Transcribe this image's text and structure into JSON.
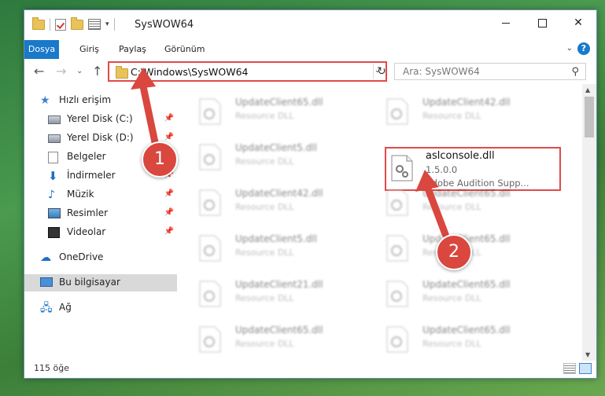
{
  "window": {
    "title": "SysWOW64",
    "controls": {
      "minimize": "",
      "maximize": "",
      "close": "✕"
    }
  },
  "ribbon": {
    "tabs": [
      "Dosya",
      "Giriş",
      "Paylaş",
      "Görünüm"
    ],
    "help": "?"
  },
  "address": {
    "path": "C:\\Windows\\SysWOW64",
    "search_placeholder": "Ara: SysWOW64"
  },
  "sidebar": {
    "items": [
      {
        "label": "Hızlı erişim",
        "icon": "star-icon"
      },
      {
        "label": "Yerel Disk (C:)",
        "icon": "disk-icon",
        "pinned": true
      },
      {
        "label": "Yerel Disk (D:)",
        "icon": "disk-icon",
        "pinned": true
      },
      {
        "label": "Belgeler",
        "icon": "document-icon",
        "pinned": true
      },
      {
        "label": "İndirmeler",
        "icon": "download-icon",
        "pinned": true
      },
      {
        "label": "Müzik",
        "icon": "music-icon",
        "pinned": true
      },
      {
        "label": "Resimler",
        "icon": "pictures-icon",
        "pinned": true
      },
      {
        "label": "Videolar",
        "icon": "video-icon",
        "pinned": true
      },
      {
        "label": "OneDrive",
        "icon": "cloud-icon"
      },
      {
        "label": "Bu bilgisayar",
        "icon": "computer-icon",
        "selected": true
      },
      {
        "label": "Ağ",
        "icon": "network-icon"
      }
    ]
  },
  "files": {
    "left": [
      {
        "name": "UpdateClient65.dll",
        "type": "Resource DLL"
      },
      {
        "name": "UpdateClient5.dll",
        "type": "Resource DLL"
      },
      {
        "name": "UpdateClient42.dll",
        "type": "Resource DLL"
      },
      {
        "name": "UpdateClient5.dll",
        "type": "Resource DLL"
      },
      {
        "name": "UpdateClient21.dll",
        "type": "Resource DLL"
      },
      {
        "name": "UpdateClient65.dll",
        "type": "Resource DLL"
      }
    ],
    "right": [
      {
        "name": "UpdateClient42.dll",
        "type": "Resource DLL"
      },
      {
        "name": "UpdateClient65.dll",
        "type": "Resource DLL"
      },
      {
        "name": "UpdateClient65.dll",
        "type": "Resource DLL"
      },
      {
        "name": "UpdateClient65.dll",
        "type": "Resource DLL"
      },
      {
        "name": "UpdateClient65.dll",
        "type": "Resource DLL"
      }
    ],
    "focused": {
      "name": "aslconsole.dll",
      "version": "1.5.0.0",
      "description": "Adobe Audition Supp..."
    }
  },
  "status": {
    "item_count": "115 öğe"
  },
  "annotations": {
    "step1": "1",
    "step2": "2",
    "color": "#d9473f"
  }
}
